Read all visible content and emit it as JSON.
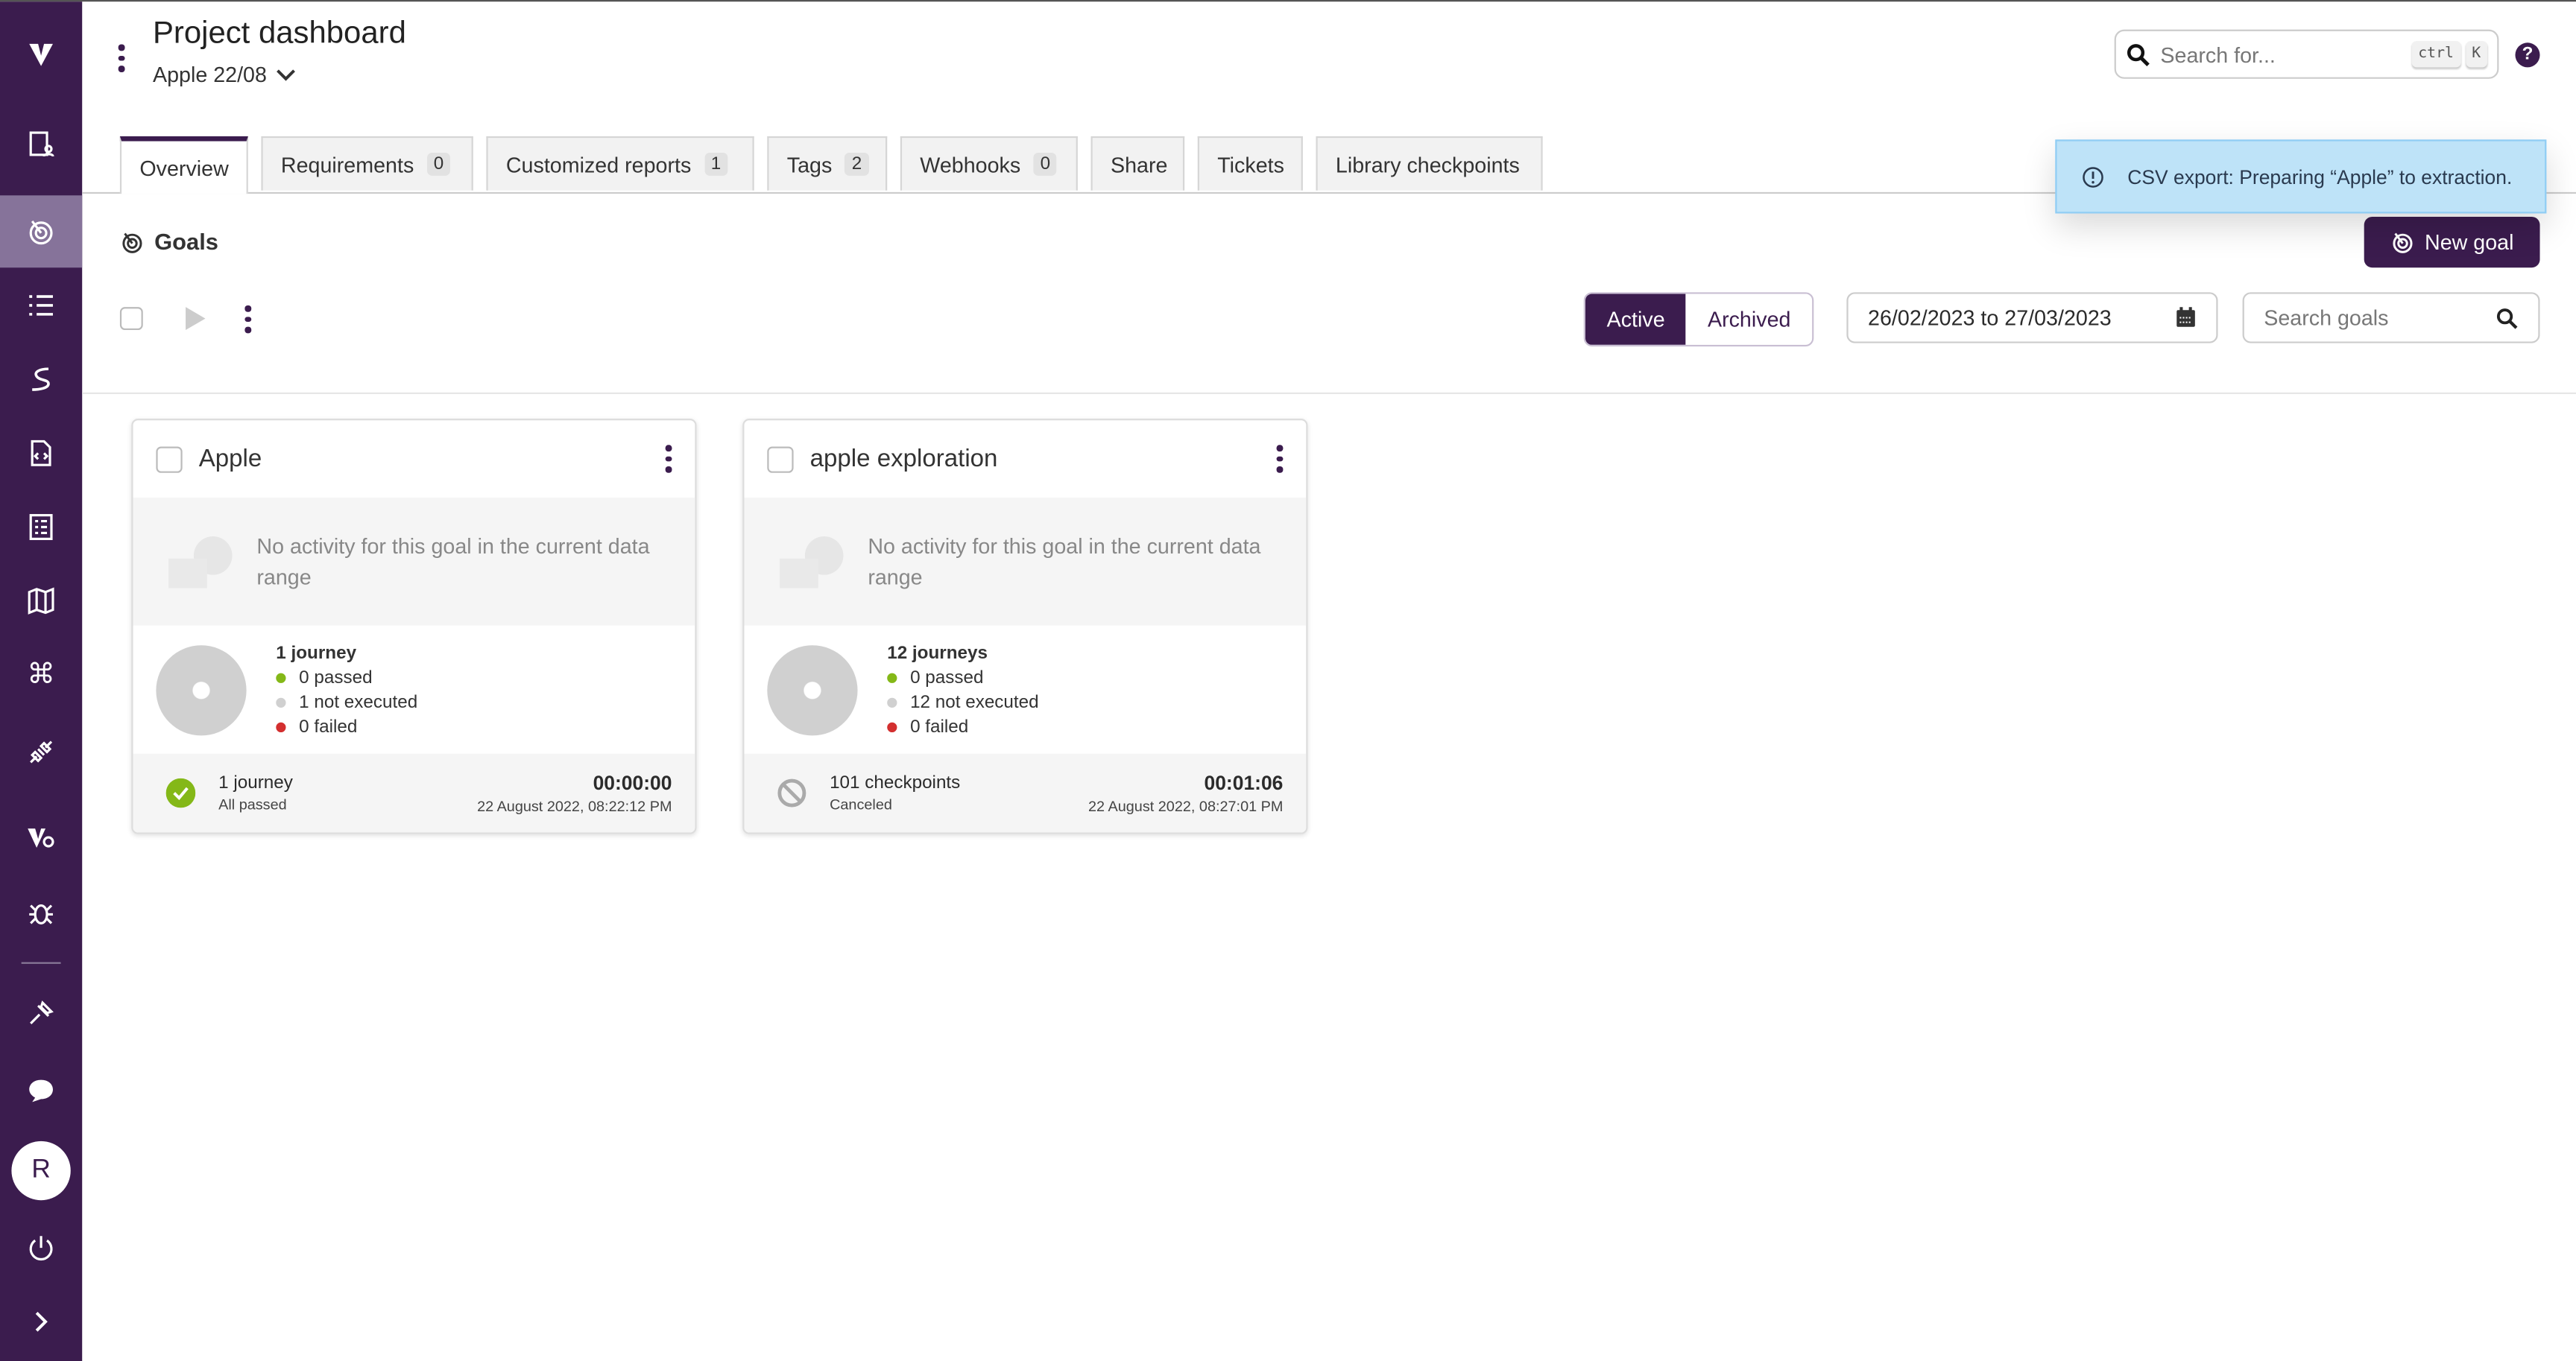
{
  "colors": {
    "brand": "#3b1c4e",
    "sidebar_active": "#86739a",
    "toast_bg": "#bee3f8",
    "passed": "#84b818",
    "not_executed": "#d0d0d0",
    "failed": "#d32f2f"
  },
  "sidebar": {
    "items": [
      {
        "icon": "logo-v-icon"
      },
      {
        "icon": "dashboard-user-icon"
      },
      {
        "icon": "goals-target-icon",
        "active": true
      },
      {
        "icon": "list-icon"
      },
      {
        "icon": "route-icon"
      },
      {
        "icon": "code-file-icon"
      },
      {
        "icon": "checklist-icon"
      },
      {
        "icon": "map-icon"
      },
      {
        "icon": "command-icon"
      },
      {
        "icon": "plug-icon"
      },
      {
        "icon": "v-gear-icon"
      },
      {
        "icon": "bug-icon"
      },
      {
        "icon": "pin-tool-icon"
      },
      {
        "icon": "chat-icon"
      },
      {
        "icon": "power-icon"
      },
      {
        "icon": "chevron-right-icon"
      }
    ],
    "avatar": "R"
  },
  "header": {
    "title": "Project dashboard",
    "project": "Apple 22/08",
    "search_placeholder": "Search for...",
    "kbd_ctrl": "ctrl",
    "kbd_k": "K",
    "help": "?"
  },
  "tabs": [
    {
      "label": "Overview",
      "active": true
    },
    {
      "label": "Requirements",
      "count": "0"
    },
    {
      "label": "Customized reports",
      "count": "1"
    },
    {
      "label": "Tags",
      "count": "2"
    },
    {
      "label": "Webhooks",
      "count": "0"
    },
    {
      "label": "Share"
    },
    {
      "label": "Tickets"
    },
    {
      "label": "Library checkpoints"
    }
  ],
  "toast": {
    "message": "CSV export: Preparing “Apple” to extraction."
  },
  "goals": {
    "heading": "Goals",
    "new_goal": "New goal",
    "filter": {
      "active": "Active",
      "archived": "Archived",
      "selected": "Active"
    },
    "date_range": "26/02/2023 to 27/03/2023",
    "search_placeholder": "Search goals",
    "cards": [
      {
        "name": "Apple",
        "empty": "No activity for this goal in the current data range",
        "journeys": "1 journey",
        "passed": "0 passed",
        "not_executed": "1 not executed",
        "failed": "0 failed",
        "footer_title": "1 journey",
        "footer_status": "All passed",
        "status_icon": "check-circle-icon",
        "duration": "00:00:00",
        "date": "22 August 2022, 08:22:12 PM"
      },
      {
        "name": "apple exploration",
        "empty": "No activity for this goal in the current data range",
        "journeys": "12 journeys",
        "passed": "0 passed",
        "not_executed": "12 not executed",
        "failed": "0 failed",
        "footer_title": "101 checkpoints",
        "footer_status": "Canceled",
        "status_icon": "canceled-icon",
        "duration": "00:01:06",
        "date": "22 August 2022, 08:27:01 PM"
      }
    ]
  }
}
